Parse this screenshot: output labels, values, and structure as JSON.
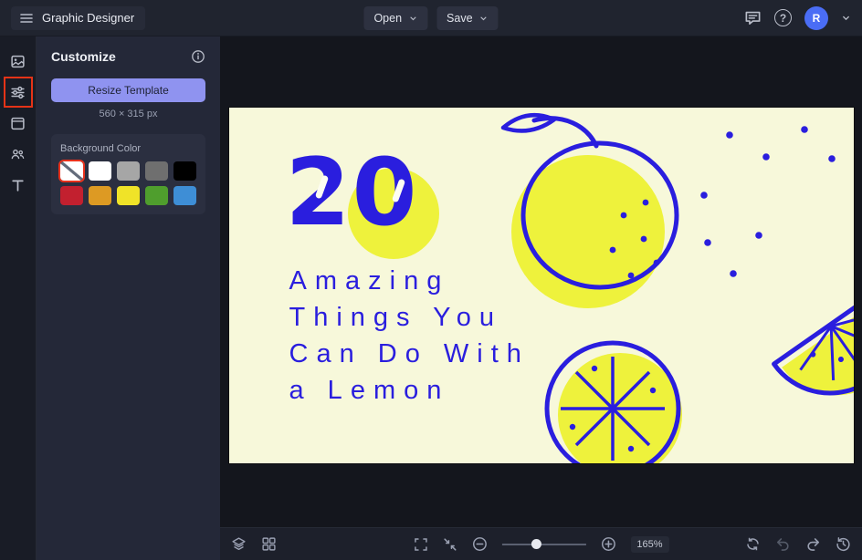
{
  "topbar": {
    "app_title": "Graphic Designer",
    "open_label": "Open",
    "save_label": "Save",
    "avatar_initial": "R",
    "help_glyph": "?"
  },
  "panel": {
    "title": "Customize",
    "resize_button": "Resize Template",
    "dimensions": "560 × 315 px",
    "background_color_label": "Background Color",
    "background_colors": [
      {
        "name": "none",
        "value": "none",
        "selected": true
      },
      {
        "name": "white",
        "value": "#ffffff"
      },
      {
        "name": "light-gray",
        "value": "#a6a6a6"
      },
      {
        "name": "gray",
        "value": "#6f6f6f"
      },
      {
        "name": "black",
        "value": "#000000"
      },
      {
        "name": "red",
        "value": "#c2202f"
      },
      {
        "name": "orange",
        "value": "#dd9a23"
      },
      {
        "name": "yellow",
        "value": "#f0e328"
      },
      {
        "name": "green",
        "value": "#4f9e2d"
      },
      {
        "name": "blue",
        "value": "#3e8ed6"
      }
    ],
    "highlight_color": "#e53317"
  },
  "artboard": {
    "big_number": "20",
    "headline_lines": [
      "Amazing",
      "Things You",
      "Can Do With",
      "a Lemon"
    ],
    "colors": {
      "background": "#f7f8da",
      "ink": "#2a1ede",
      "accent": "#eef23c"
    }
  },
  "toolbar": {
    "zoom_level": "165%"
  }
}
